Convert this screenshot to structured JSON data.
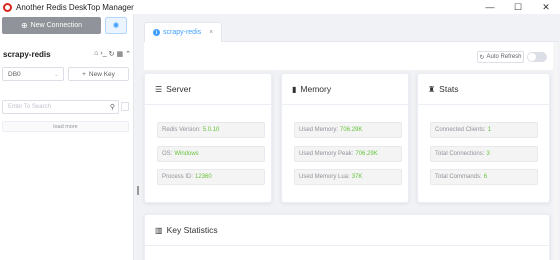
{
  "window": {
    "title": "Another Redis DeskTop Manager",
    "controls": [
      "—",
      "☐",
      "✕"
    ]
  },
  "sidebar": {
    "new_connection_label": "New Connection",
    "connection_name": "scrapy-redis",
    "db_select_value": "DB0",
    "new_key_label": "New Key",
    "search_placeholder": "Enter To Search",
    "load_more_label": "load more"
  },
  "tabs": [
    {
      "label": "scrapy-redis"
    }
  ],
  "toolbar": {
    "auto_refresh_label": "Auto Refresh"
  },
  "server": {
    "title": "Server",
    "redis_version_label": "Redis Version:",
    "redis_version_value": "5.0.10",
    "os_label": "OS:",
    "os_value": "Windows",
    "process_id_label": "Process ID:",
    "process_id_value": "12360"
  },
  "memory": {
    "title": "Memory",
    "used_memory_label": "Used Memory:",
    "used_memory_value": "706.29K",
    "used_memory_peak_label": "Used Memory Peak:",
    "used_memory_peak_value": "706.29K",
    "used_memory_lua_label": "Used Memory Lua:",
    "used_memory_lua_value": "37K"
  },
  "stats": {
    "title": "Stats",
    "connected_clients_label": "Connected Clients:",
    "connected_clients_value": "1",
    "total_connections_label": "Total Connections:",
    "total_connections_value": "3",
    "total_commands_label": "Total Commands:",
    "total_commands_value": "6"
  },
  "key_statistics": {
    "title": "Key Statistics"
  },
  "colors": {
    "accent": "#409eff",
    "value_green": "#67c23a",
    "new_connection_bg": "#909399"
  }
}
